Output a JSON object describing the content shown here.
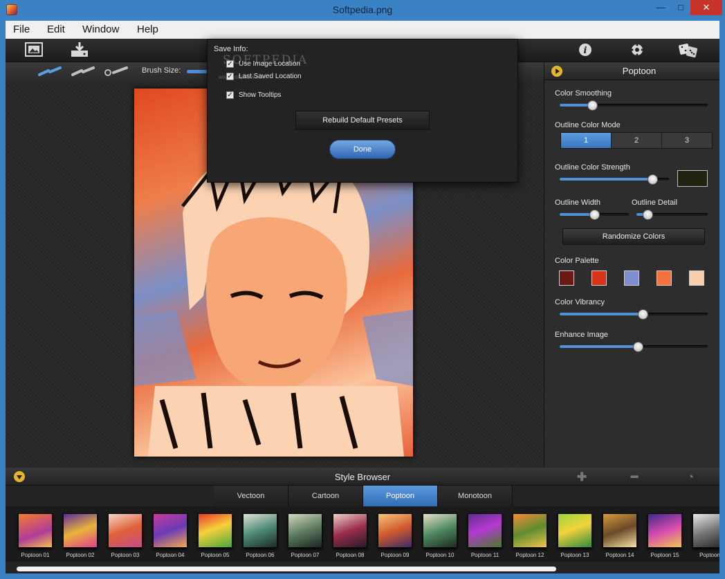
{
  "window": {
    "title": "Softpedia.png",
    "min_glyph": "—",
    "max_glyph": "□",
    "close_glyph": "✕"
  },
  "menu": [
    "File",
    "Edit",
    "Window",
    "Help"
  ],
  "subbar": {
    "brush_size_label": "Brush Size:"
  },
  "panel": {
    "title": "Poptoon",
    "color_smoothing": {
      "label": "Color Smoothing",
      "value": 0.22
    },
    "outline_color_mode": {
      "label": "Outline Color Mode",
      "options": [
        "1",
        "2",
        "3"
      ],
      "selected": "1"
    },
    "outline_color_strength": {
      "label": "Outline Color Strength",
      "value": 0.85,
      "color": "#1f2410"
    },
    "outline_width": {
      "label": "Outline Width",
      "value": 0.5
    },
    "outline_detail": {
      "label": "Outline Detail",
      "value": 0.16
    },
    "randomize_label": "Randomize Colors",
    "color_palette": {
      "label": "Color Palette",
      "colors": [
        "#6a1a12",
        "#d9341b",
        "#7d8ecf",
        "#f4733a",
        "#fbcfae"
      ]
    },
    "color_vibrancy": {
      "label": "Color Vibrancy",
      "value": 0.56
    },
    "enhance_image": {
      "label": "Enhance Image",
      "value": 0.53
    }
  },
  "style_browser": {
    "title": "Style Browser",
    "add_glyph": "✚",
    "remove_glyph": "━",
    "refresh_glyph": "◔",
    "tabs": [
      "Vectoon",
      "Cartoon",
      "Poptoon",
      "Monotoon"
    ],
    "active_tab": "Poptoon",
    "thumbnails": [
      "Poptoon 01",
      "Poptoon 02",
      "Poptoon 03",
      "Poptoon 04",
      "Poptoon 05",
      "Poptoon 06",
      "Poptoon 07",
      "Poptoon 08",
      "Poptoon 09",
      "Poptoon 10",
      "Poptoon 11",
      "Poptoon 12",
      "Poptoon 13",
      "Poptoon 14",
      "Poptoon 15",
      "Poptoon"
    ]
  },
  "dialog": {
    "save_info_label": "Save Info:",
    "watermark": "SOFTPEDIA",
    "watermark_sub": "www.softpedia.com",
    "use_image_location": {
      "label": "Use Image Location",
      "checked": true
    },
    "last_saved_location": {
      "label": "Last Saved Location",
      "checked": true
    },
    "show_tooltips": {
      "label": "Show Tooltips",
      "checked": true
    },
    "rebuild_label": "Rebuild Default Presets",
    "done_label": "Done"
  },
  "colors": {
    "accent": "#4f90d8",
    "title_bar": "#3b82c4",
    "close_button": "#c7332a",
    "panel_bg": "#2d2d2d",
    "toggle_yellow": "#e5b52a"
  }
}
